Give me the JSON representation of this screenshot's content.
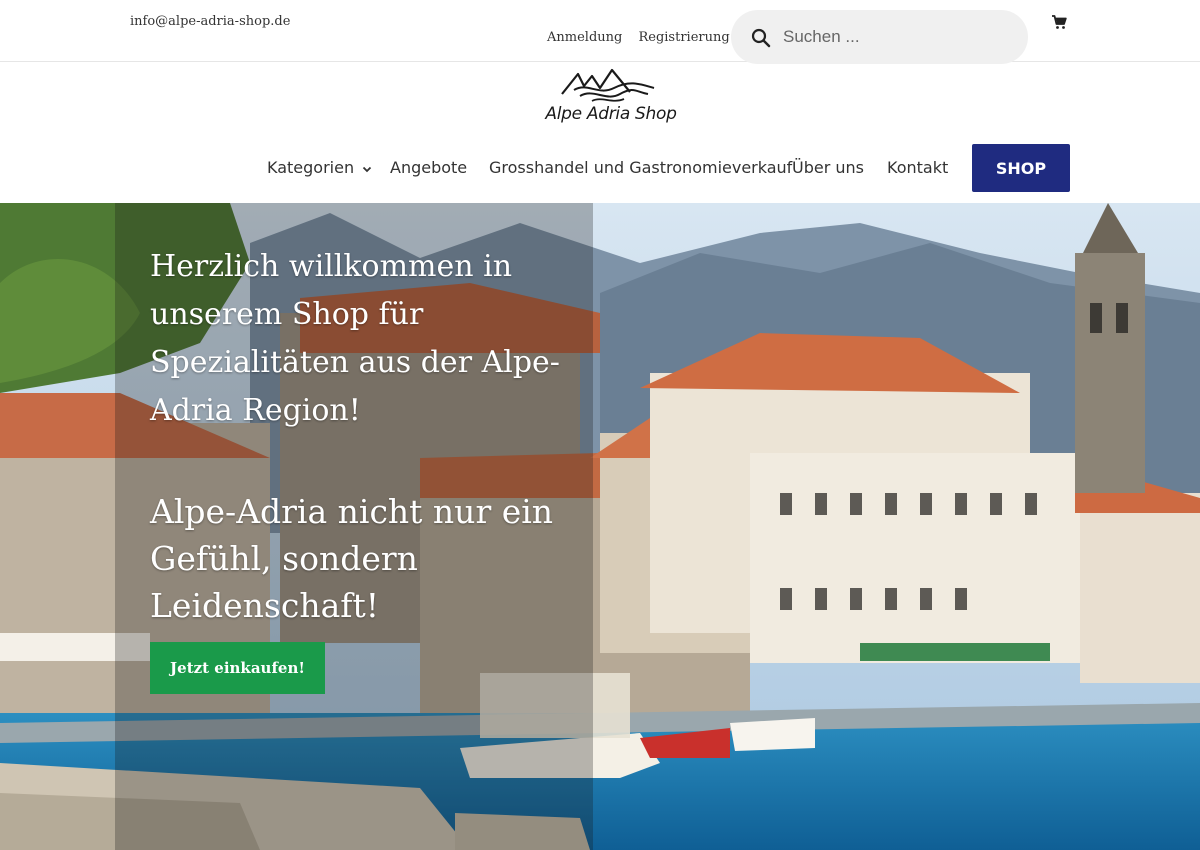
{
  "topbar": {
    "email": "info@alpe-adria-shop.de",
    "login": "Anmeldung",
    "register": "Registrierung",
    "search_placeholder": "Suchen ..."
  },
  "logo": {
    "text": "Alpe Adria Shop"
  },
  "nav": {
    "items": [
      "Kategorien",
      "Angebote",
      "Grosshandel und Gastronomieverkauf",
      "Über uns",
      "Kontakt"
    ],
    "shop_button": "SHOP"
  },
  "hero": {
    "headline": "Herzlich willkommen in unserem Shop für Spezialitäten aus der Alpe-Adria Region!",
    "subheadline": "Alpe-Adria nicht nur ein Gefühl, sondern Leidenschaft!",
    "cta": "Jetzt einkaufen!"
  },
  "colors": {
    "shop_button": "#1f2b80",
    "cta_button": "#1a9a4a"
  },
  "icons": [
    "search-icon",
    "cart-icon",
    "chevron-down-icon"
  ]
}
